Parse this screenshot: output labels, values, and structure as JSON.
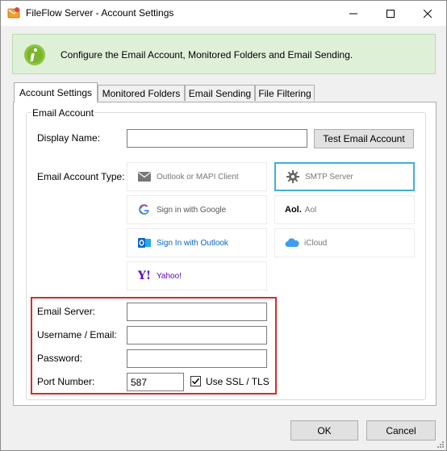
{
  "window": {
    "title": "FileFlow Server - Account Settings"
  },
  "banner": {
    "text": "Configure the Email Account, Monitored Folders and Email Sending."
  },
  "tabs": [
    {
      "label": "Account Settings"
    },
    {
      "label": "Monitored Folders"
    },
    {
      "label": "Email Sending"
    },
    {
      "label": "File Filtering"
    }
  ],
  "email_account": {
    "group_title": "Email Account",
    "display_name_label": "Display Name:",
    "display_name_value": "",
    "test_button": "Test Email Account",
    "account_type_label": "Email Account Type:",
    "account_types": [
      {
        "label": "Outlook or MAPI Client",
        "icon": "envelope-icon"
      },
      {
        "label": "SMTP Server",
        "icon": "gear-icon",
        "selected": true
      },
      {
        "label": "Sign in with Google",
        "icon": "google-icon"
      },
      {
        "label": "Aol",
        "icon": "aol-icon",
        "logo_text": "Aol."
      },
      {
        "label": "Sign In with Outlook",
        "icon": "outlook-icon"
      },
      {
        "label": "iCloud",
        "icon": "cloud-icon"
      },
      {
        "label": "Yahoo!",
        "icon": "yahoo-icon",
        "logo_text": "Y!"
      }
    ]
  },
  "server": {
    "email_server_label": "Email Server:",
    "email_server_value": "",
    "username_label": "Username / Email:",
    "username_value": "",
    "password_label": "Password:",
    "password_value": "",
    "port_label": "Port Number:",
    "port_value": "587",
    "ssl_label": "Use SSL / TLS",
    "ssl_checked": true
  },
  "footer": {
    "ok": "OK",
    "cancel": "Cancel"
  },
  "colors": {
    "accent": "#3fb0d8",
    "highlight": "#d62b2b",
    "banner_bg": "#dff0d8",
    "info_green": "#8cc63f"
  }
}
